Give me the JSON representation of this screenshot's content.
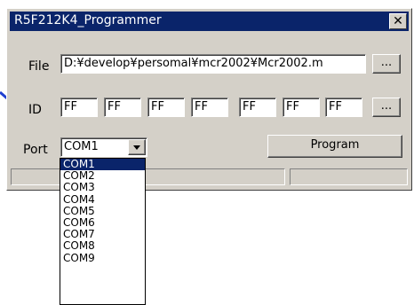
{
  "window": {
    "title": "R5F212K4_Programmer",
    "close_glyph": "✕"
  },
  "file": {
    "label": "File",
    "value": "D:¥develop¥persomal¥mcr2002¥Mcr2002.m",
    "browse_label": "..."
  },
  "id": {
    "label": "ID",
    "values": [
      "FF",
      "FF",
      "FF",
      "FF",
      "FF",
      "FF",
      "FF"
    ],
    "more_label": "..."
  },
  "port": {
    "label": "Port",
    "selected": "COM1",
    "options": [
      "COM1",
      "COM2",
      "COM3",
      "COM4",
      "COM5",
      "COM6",
      "COM7",
      "COM8",
      "COM9"
    ]
  },
  "program_button": "Program",
  "annotation": {
    "arrow_color": "#1f3fd0"
  }
}
